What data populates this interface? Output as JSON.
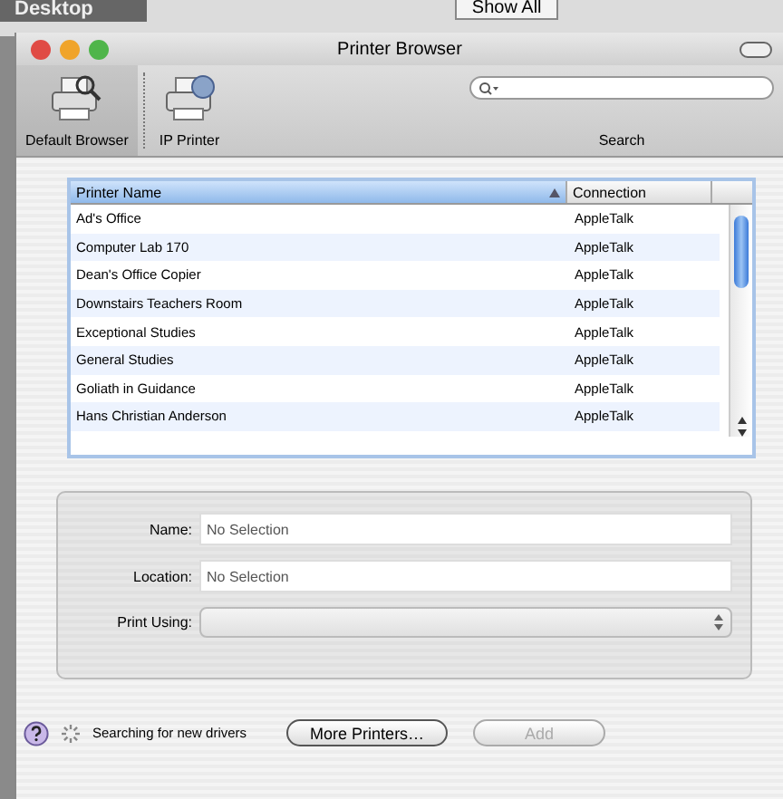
{
  "background": {
    "title": "Desktop",
    "button": "Show All"
  },
  "window": {
    "title": "Printer Browser"
  },
  "toolbar": {
    "items": [
      {
        "label": "Default Browser",
        "selected": true
      },
      {
        "label": "IP Printer",
        "selected": false
      }
    ],
    "search": {
      "label": "Search"
    }
  },
  "table": {
    "columns": [
      {
        "label": "Printer Name",
        "sorted": true
      },
      {
        "label": "Connection",
        "sorted": false
      }
    ],
    "rows": [
      {
        "name": "Ad's Office",
        "connection": "AppleTalk"
      },
      {
        "name": "Computer Lab 170",
        "connection": "AppleTalk"
      },
      {
        "name": "Dean's Office Copier",
        "connection": "AppleTalk"
      },
      {
        "name": "Downstairs Teachers Room",
        "connection": "AppleTalk"
      },
      {
        "name": "Exceptional Studies",
        "connection": "AppleTalk"
      },
      {
        "name": "General Studies",
        "connection": "AppleTalk"
      },
      {
        "name": "Goliath in Guidance",
        "connection": "AppleTalk"
      },
      {
        "name": "Hans Christian Anderson",
        "connection": "AppleTalk"
      }
    ]
  },
  "details": {
    "fields": [
      {
        "label": "Name:",
        "value": "No Selection",
        "kind": "text"
      },
      {
        "label": "Location:",
        "value": "No Selection",
        "kind": "text"
      },
      {
        "label": "Print Using:",
        "kind": "popup"
      }
    ]
  },
  "status": {
    "text": "Searching for new drivers"
  },
  "buttons": [
    {
      "label": "More Printers…",
      "disabled": false
    },
    {
      "label": "Add",
      "disabled": true
    }
  ]
}
